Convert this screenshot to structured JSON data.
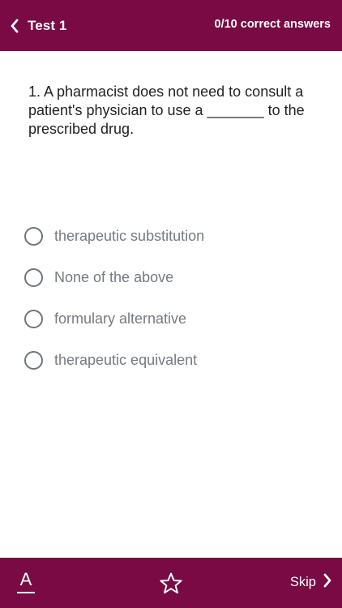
{
  "header": {
    "back_icon": "chevron-left-icon",
    "title": "Test 1",
    "score": "0/10 correct answers"
  },
  "question": {
    "text": "1. A pharmacist does not need to consult a patient's physician to use a _______ to the prescribed drug."
  },
  "options": [
    {
      "label": "therapeutic substitution",
      "selected": false
    },
    {
      "label": "None of the above",
      "selected": false
    },
    {
      "label": "formulary alternative",
      "selected": false
    },
    {
      "label": "therapeutic equivalent",
      "selected": false
    }
  ],
  "footer": {
    "font_button_letter": "A",
    "favorite_icon": "star-outline-icon",
    "skip_label": "Skip",
    "skip_icon": "chevron-right-icon"
  },
  "colors": {
    "brand": "#7a0a43",
    "option_text": "#757b82",
    "question_text": "#222222"
  }
}
